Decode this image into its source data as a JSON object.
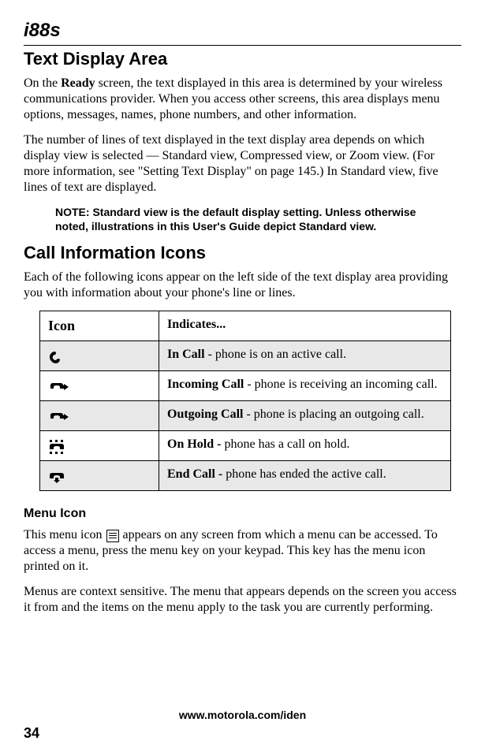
{
  "logo": "i88s",
  "h1_text_display": "Text Display Area",
  "p_ready": "On the Ready screen, the text displayed in this area is determined by your wireless communications provider. When you access other screens, this area displays menu options, messages, names, phone numbers, and other information.",
  "p_lines": "The number of lines of text displayed in the text display area depends on which display view is selected — Standard view, Compressed view, or Zoom view. (For more information, see \"Setting Text Display\" on page 145.) In Standard view, five lines of text are displayed.",
  "note_label": "NOTE:",
  "note_text": "Standard view is the default display setting. Unless otherwise noted, illustrations in this User's Guide depict Standard view.",
  "h1_call_info": "Call Information Icons",
  "p_call_info": "Each of the following icons appear on the left side of the text display area providing you with information about your phone's line or lines.",
  "table": {
    "headers": {
      "icon": "Icon",
      "indicates": "Indicates..."
    },
    "rows": [
      {
        "name": "In Call",
        "desc": " - phone is on an active call."
      },
      {
        "name": "Incoming Call",
        "desc": " - phone is receiving an incoming call."
      },
      {
        "name": "Outgoing Call",
        "desc": " - phone is placing an outgoing call."
      },
      {
        "name": "On Hold - ",
        "desc": "phone has a call on hold."
      },
      {
        "name": "End Call - ",
        "desc": "phone has ended the active call."
      }
    ]
  },
  "h2_menu": "Menu Icon",
  "p_menu1a": "This menu icon ",
  "p_menu1b": " appears on any screen from which a menu can be accessed. To access a menu, press the menu key on your keypad. This key has the menu icon printed on it.",
  "p_menu2": "Menus are context sensitive. The menu that appears depends on the screen you access it from and the items on the menu apply to the task you are currently performing.",
  "footer_url": "www.motorola.com/iden",
  "page_num": "34"
}
